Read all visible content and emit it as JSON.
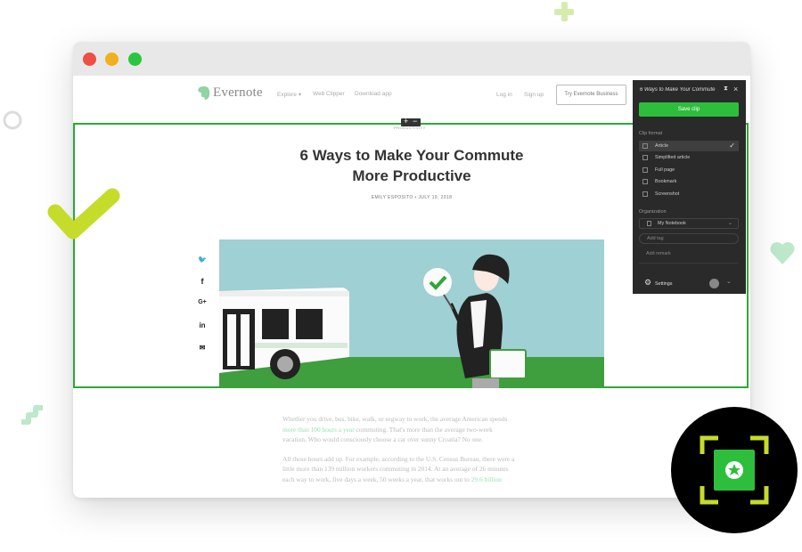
{
  "nav": {
    "logo_text": "Evernote",
    "explore": "Explore ▾",
    "web_clipper": "Web Clipper",
    "download_app": "Download app",
    "log_in": "Log in",
    "sign_up": "Sign up",
    "try_business": "Try Evernote Business"
  },
  "article": {
    "kicker": "PRODUCTIVITY",
    "title_line1": "6 Ways to Make Your Commute",
    "title_line2": "More Productive",
    "byline": "EMILY ESPOSITO • JULY 19, 2018",
    "p1_a": "Whether you drive, bus, bike, walk, or segway to work, the average American spends",
    "p1_link": "more than 100 hours a year",
    "p1_b": " commuting. That's more than the average two-week",
    "p1_c": "vacation. Who would consciously choose a car over sunny Croatia? No one.",
    "p2_a": "All those hours add up. For example, according to the U.S. Census Bureau, there were a",
    "p2_b": "little more than 139 million workers commuting in 2014. At an average of 26 minutes",
    "p2_c": "each way to work, five days a week, 50 weeks a year, that works out to ",
    "p2_link": "29.6 billion",
    "social": [
      "twitter-icon",
      "facebook-icon",
      "google-plus-icon",
      "linkedin-icon",
      "email-icon"
    ],
    "social_glyphs": [
      "🐦",
      "f",
      "G+",
      "in",
      "✉"
    ]
  },
  "selection": {
    "plus": "+",
    "minus": "−"
  },
  "clipper": {
    "note_title": "6 Ways to Make Your Commute",
    "save_label": "Save clip",
    "clip_format_label": "Clip format",
    "formats": [
      {
        "label": "Article",
        "selected": true
      },
      {
        "label": "Simplified article",
        "selected": false
      },
      {
        "label": "Full page",
        "selected": false
      },
      {
        "label": "Bookmark",
        "selected": false
      },
      {
        "label": "Screenshot",
        "selected": false
      }
    ],
    "organization_label": "Organization",
    "notebook": "My Notebook",
    "tag_placeholder": "Add tag",
    "remark_placeholder": "Add remark",
    "settings_label": "Settings"
  },
  "colors": {
    "accent_green": "#2dbe3c",
    "selection_border": "#2ea836",
    "lime": "#c6dc2a",
    "panel_bg": "#2a2a2a"
  }
}
